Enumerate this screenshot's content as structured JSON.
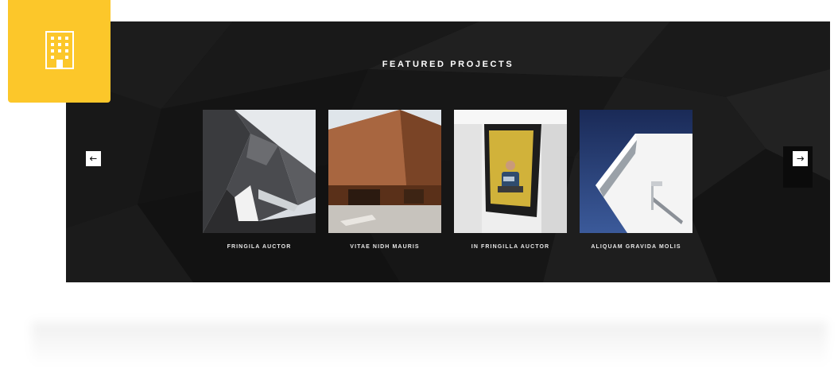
{
  "section": {
    "title": "FEATURED PROJECTS"
  },
  "navigation": {
    "prev_icon": "arrow-left-icon",
    "next_icon": "arrow-right-icon"
  },
  "projects": [
    {
      "title": "FRINGILA AUCTOR",
      "image": "angular-dark-building-photo"
    },
    {
      "title": "VITAE NIDH MAURIS",
      "image": "brick-cube-building-photo"
    },
    {
      "title": "IN FRINGILLA AUCTOR",
      "image": "man-in-window-box-photo"
    },
    {
      "title": "ALIQUAM GRAVIDA MOLIS",
      "image": "white-cantilever-building-photo"
    }
  ],
  "badge": {
    "icon": "office-building-icon"
  },
  "colors": {
    "accent": "#fcc72a",
    "panel_background": "#151515",
    "text": "#ffffff"
  }
}
